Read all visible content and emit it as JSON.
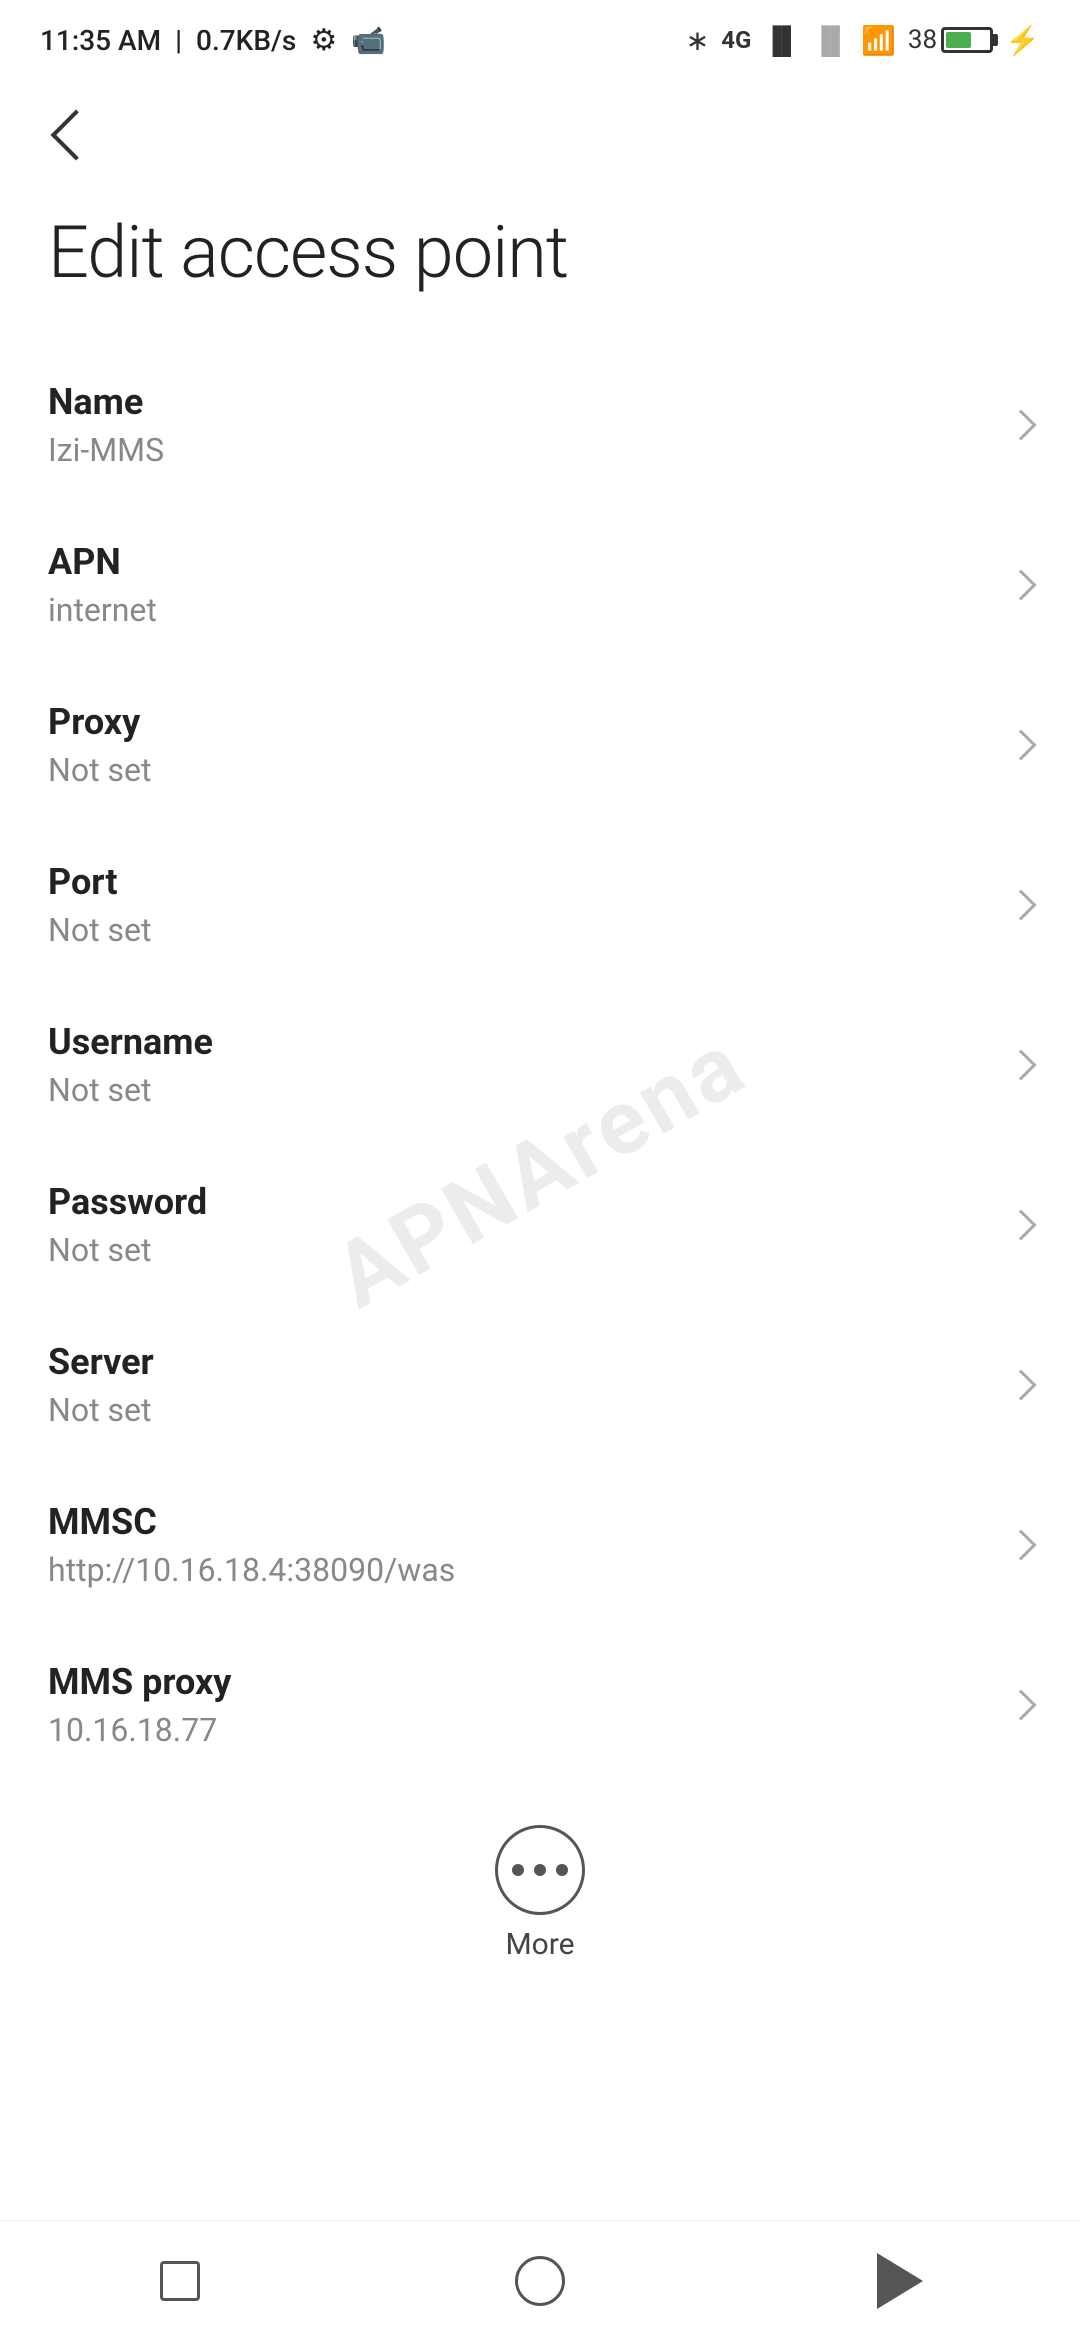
{
  "statusBar": {
    "time": "11:35 AM",
    "speed": "0.7KB/s"
  },
  "header": {
    "backLabel": "back"
  },
  "pageTitle": "Edit access point",
  "settings": [
    {
      "id": "name",
      "label": "Name",
      "value": "Izi-MMS"
    },
    {
      "id": "apn",
      "label": "APN",
      "value": "internet"
    },
    {
      "id": "proxy",
      "label": "Proxy",
      "value": "Not set"
    },
    {
      "id": "port",
      "label": "Port",
      "value": "Not set"
    },
    {
      "id": "username",
      "label": "Username",
      "value": "Not set"
    },
    {
      "id": "password",
      "label": "Password",
      "value": "Not set"
    },
    {
      "id": "server",
      "label": "Server",
      "value": "Not set"
    },
    {
      "id": "mmsc",
      "label": "MMSC",
      "value": "http://10.16.18.4:38090/was"
    },
    {
      "id": "mms-proxy",
      "label": "MMS proxy",
      "value": "10.16.18.77"
    }
  ],
  "more": {
    "label": "More"
  },
  "watermark": "APNArena"
}
